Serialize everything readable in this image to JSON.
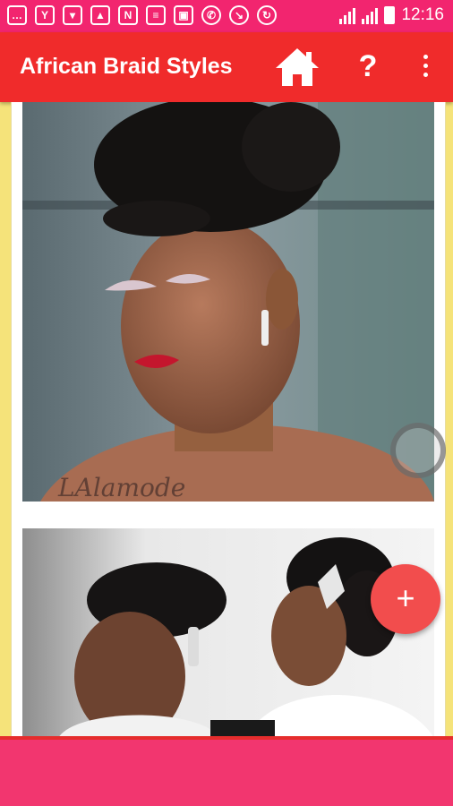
{
  "status_bar": {
    "time": "12:16",
    "icons": [
      "message-icon",
      "y-app-icon",
      "shirt-icon",
      "image-icon",
      "n-app-icon",
      "chat-icon",
      "office-icon",
      "whatsapp-icon",
      "missed-call-icon",
      "sync-icon"
    ],
    "color": "#f2256f"
  },
  "app_bar": {
    "title": "African Braid Styles",
    "help_label": "?",
    "color": "#f02b2b"
  },
  "gallery": {
    "photo1_watermark": "LAlamode"
  },
  "fab": {
    "label": "+",
    "color": "#f24d4d"
  },
  "bottom_bar": {
    "color": "#f2366f"
  }
}
